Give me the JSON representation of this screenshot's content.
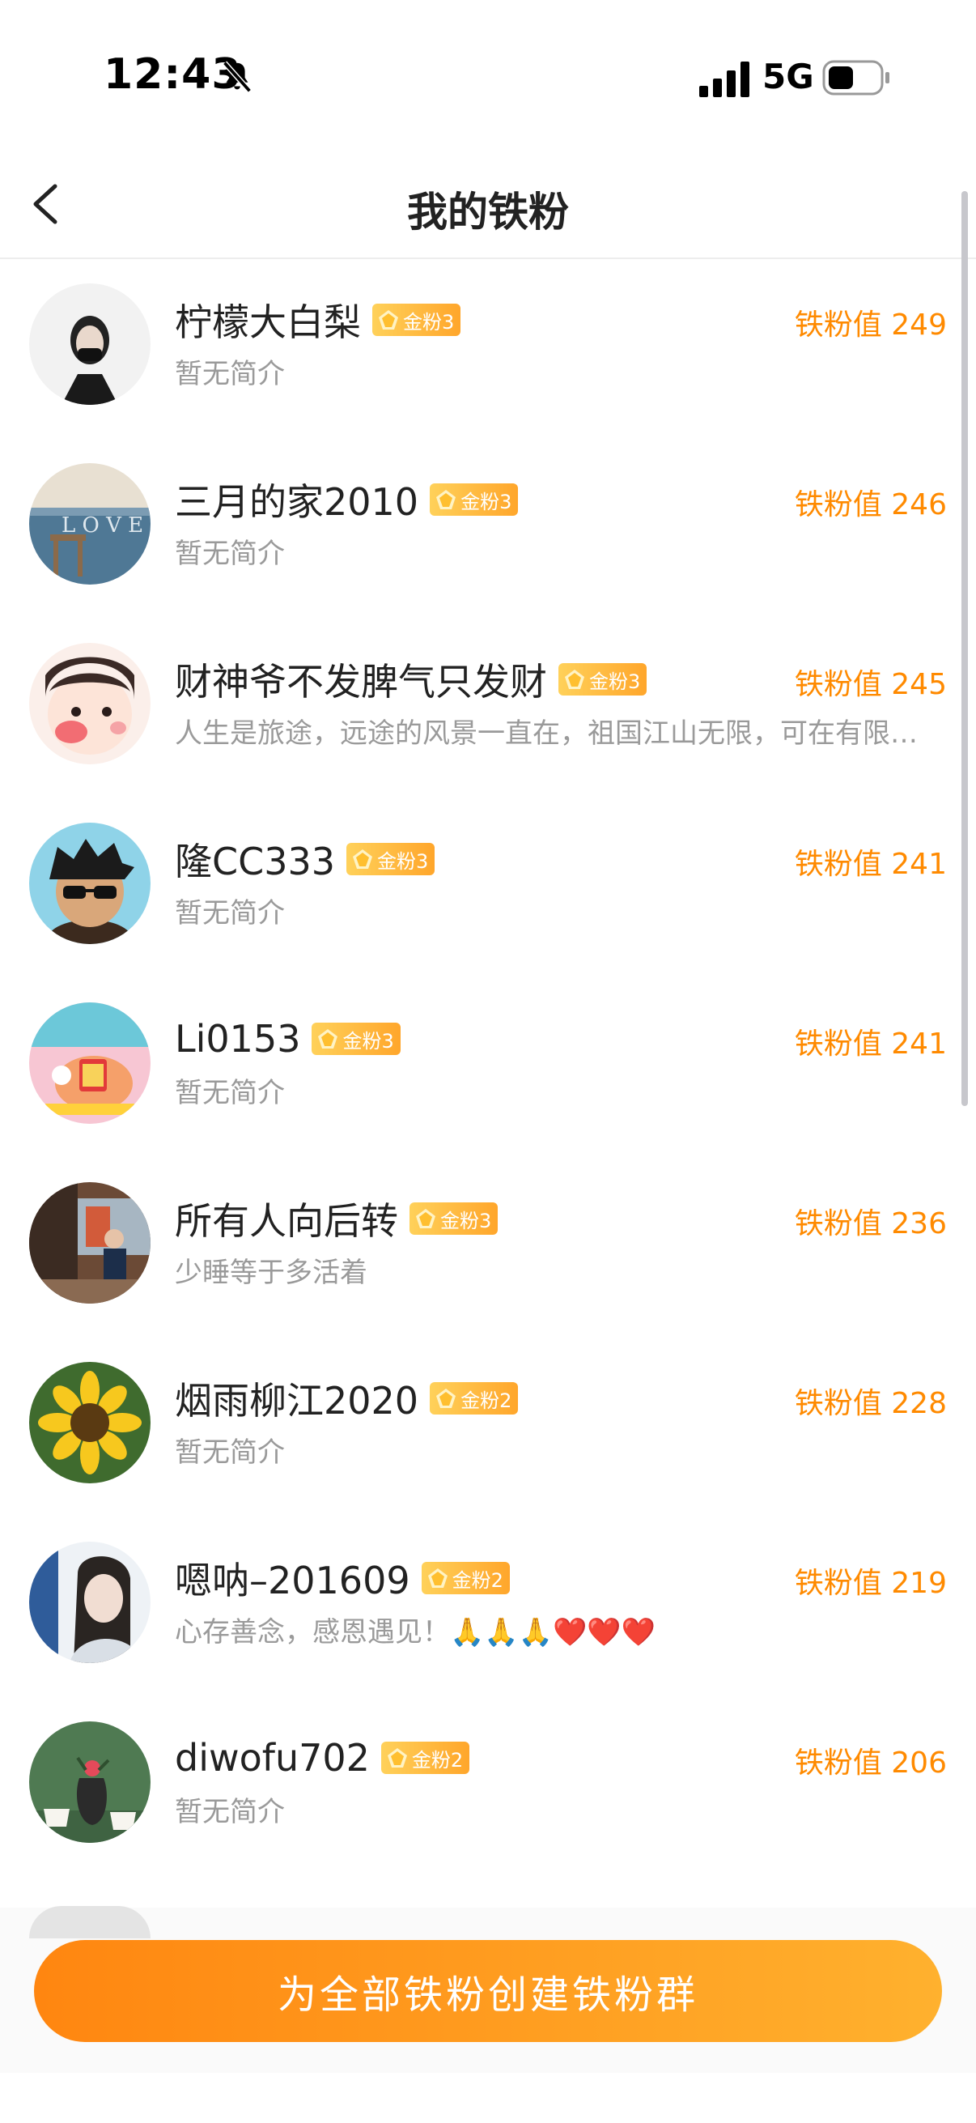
{
  "status_bar": {
    "time": "12:43",
    "network": "5G"
  },
  "nav": {
    "title": "我的铁粉"
  },
  "fans": [
    {
      "name": "柠檬大白梨",
      "badge": "金粉3",
      "value": "铁粉值 249",
      "bio": "暂无简介",
      "avatar": "avatar-woman-mask"
    },
    {
      "name": "三月的家2010",
      "badge": "金粉3",
      "value": "铁粉值 246",
      "bio": "暂无简介",
      "avatar": "avatar-seaside"
    },
    {
      "name": "财神爷不发脾气只发财",
      "badge": "金粉3",
      "value": "铁粉值 245",
      "bio": "人生是旅途，远途的风景一直在，祖国江山无限，可在有限的时间里…",
      "avatar": "avatar-cartoon-girl"
    },
    {
      "name": "隆CC333",
      "badge": "金粉3",
      "value": "铁粉值 241",
      "bio": "暂无简介",
      "avatar": "avatar-anime-sunglasses"
    },
    {
      "name": "Li0153",
      "badge": "金粉3",
      "value": "铁粉值 241",
      "bio": "暂无简介",
      "avatar": "avatar-fortune"
    },
    {
      "name": "所有人向后转",
      "badge": "金粉3",
      "value": "铁粉值 236",
      "bio": "少睡等于多活着",
      "avatar": "avatar-street"
    },
    {
      "name": "烟雨柳江2020",
      "badge": "金粉2",
      "value": "铁粉值 228",
      "bio": "暂无简介",
      "avatar": "avatar-sunflower"
    },
    {
      "name": "嗯呐–201609",
      "badge": "金粉2",
      "value": "铁粉值 219",
      "bio": "心存善念，感恩遇见！🙏🙏🙏❤️❤️❤️",
      "avatar": "avatar-woman-portrait"
    },
    {
      "name": "diwofu702",
      "badge": "金粉2",
      "value": "铁粉值 206",
      "bio": "暂无简介",
      "avatar": "avatar-tea"
    }
  ],
  "cta": {
    "label": "为全部铁粉创建铁粉群"
  },
  "colors": {
    "accent": "#ff8a00",
    "badge": "#ffb43a",
    "cta_start": "#ff8610",
    "cta_end": "#ffb12e"
  }
}
